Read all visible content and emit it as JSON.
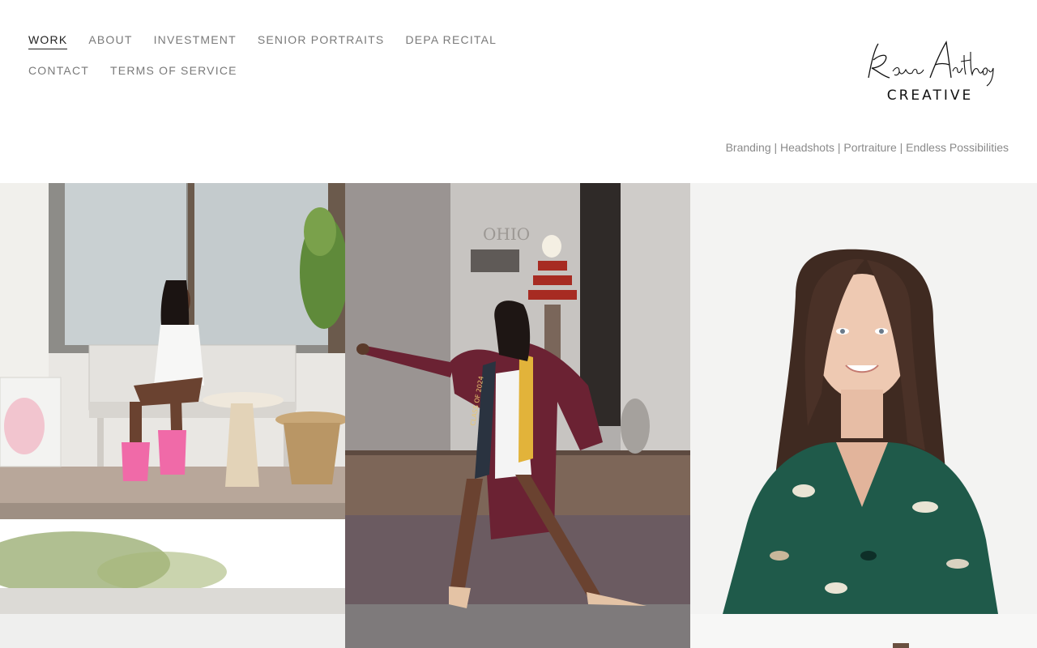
{
  "nav": {
    "items": [
      {
        "label": "WORK",
        "active": true
      },
      {
        "label": "ABOUT",
        "active": false
      },
      {
        "label": "INVESTMENT",
        "active": false
      },
      {
        "label": "SENIOR PORTRAITS",
        "active": false
      },
      {
        "label": "DEPA RECITAL",
        "active": false
      },
      {
        "label": "CONTACT",
        "active": false
      },
      {
        "label": "TERMS OF SERVICE",
        "active": false
      }
    ]
  },
  "logo": {
    "script_text": "Rance Anthony",
    "sub_text": "CREATIVE"
  },
  "tagline": "Branding | Headshots | Portraiture | Endless Possibilities",
  "gallery": {
    "tiles": [
      {
        "subject": "woman-in-white-dress-seated-on-patio",
        "icon": "photo-icon"
      },
      {
        "subject": "graduate-in-maroon-gown-class-of-2024",
        "icon": "photo-icon"
      },
      {
        "subject": "woman-headshot-green-patterned-top",
        "icon": "photo-icon"
      },
      {
        "subject": "partial-photo-bottom-left",
        "icon": "photo-icon"
      },
      {
        "subject": "partial-photo-bottom-right",
        "icon": "photo-icon"
      }
    ],
    "stole_text": "CLASS OF 2024"
  },
  "colors": {
    "nav_text": "#7a7a7a",
    "nav_active": "#222222",
    "tagline": "#8a8a8a",
    "gown": "#6b2233",
    "dress": "#f4f4f4"
  }
}
